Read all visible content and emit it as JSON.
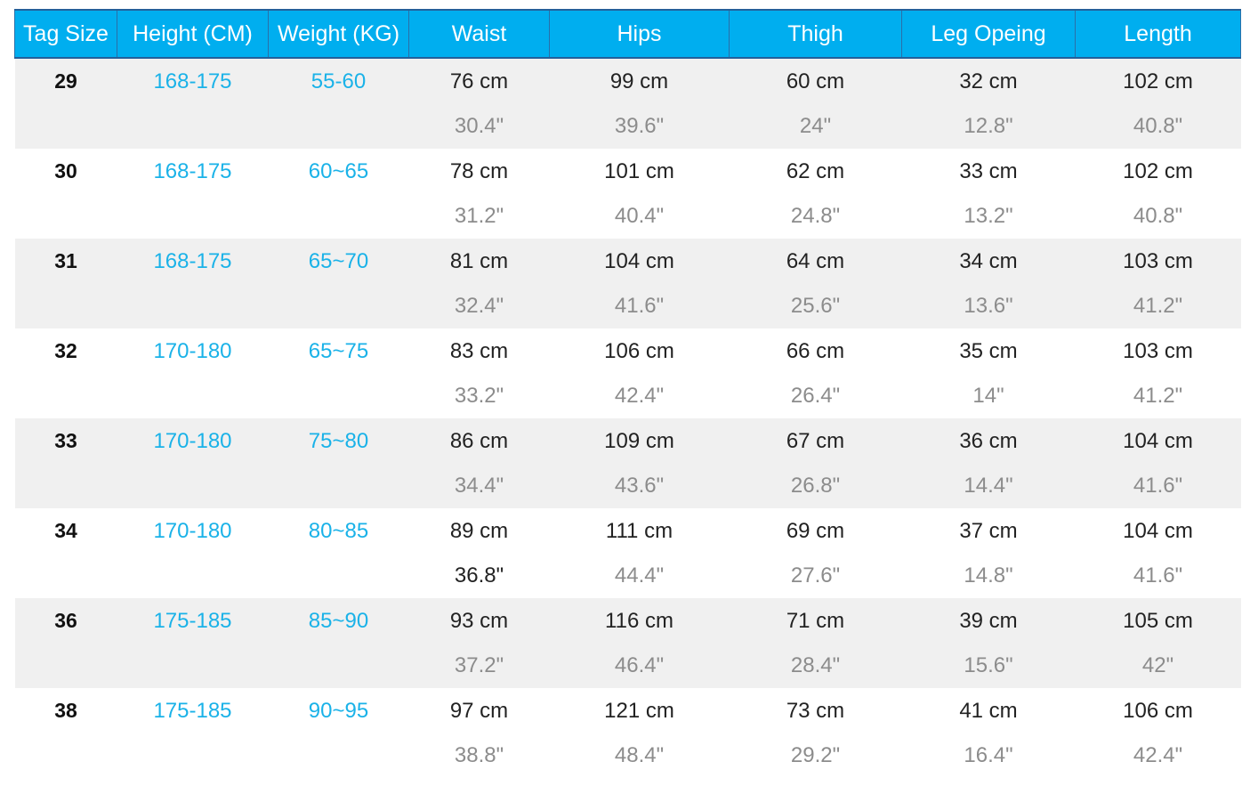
{
  "headers": [
    "Tag Size",
    "Height (CM)",
    "Weight (KG)",
    "Waist",
    "Hips",
    "Thigh",
    "Leg Opeing",
    "Length"
  ],
  "rows": [
    {
      "size": "29",
      "height": "168-175",
      "weight": "55-60",
      "cm": [
        "76 cm",
        "99 cm",
        "60 cm",
        "32 cm",
        "102 cm"
      ],
      "inch": [
        "30.4\"",
        "39.6\"",
        "24\"",
        "12.8\"",
        "40.8\""
      ]
    },
    {
      "size": "30",
      "height": "168-175",
      "weight": "60~65",
      "cm": [
        "78 cm",
        "101 cm",
        "62 cm",
        "33 cm",
        "102 cm"
      ],
      "inch": [
        "31.2\"",
        "40.4\"",
        "24.8\"",
        "13.2\"",
        "40.8\""
      ]
    },
    {
      "size": "31",
      "height": "168-175",
      "weight": "65~70",
      "cm": [
        "81 cm",
        "104 cm",
        "64 cm",
        "34 cm",
        "103 cm"
      ],
      "inch": [
        "32.4\"",
        "41.6\"",
        "25.6\"",
        "13.6\"",
        "41.2\""
      ]
    },
    {
      "size": "32",
      "height": "170-180",
      "weight": "65~75",
      "cm": [
        "83 cm",
        "106 cm",
        "66 cm",
        "35 cm",
        "103 cm"
      ],
      "inch": [
        "33.2\"",
        "42.4\"",
        "26.4\"",
        "14\"",
        "41.2\""
      ]
    },
    {
      "size": "33",
      "height": "170-180",
      "weight": "75~80",
      "cm": [
        "86 cm",
        "109 cm",
        "67 cm",
        "36 cm",
        "104 cm"
      ],
      "inch": [
        "34.4\"",
        "43.6\"",
        "26.8\"",
        "14.4\"",
        "41.6\""
      ]
    },
    {
      "size": "34",
      "height": "170-180",
      "weight": "80~85",
      "cm": [
        "89 cm",
        "111 cm",
        "69 cm",
        "37 cm",
        "104 cm"
      ],
      "inch": [
        "36.8\"",
        "44.4\"",
        "27.6\"",
        "14.8\"",
        "41.6\""
      ]
    },
    {
      "size": "36",
      "height": "175-185",
      "weight": "85~90",
      "cm": [
        "93 cm",
        "116 cm",
        "71 cm",
        "39 cm",
        "105 cm"
      ],
      "inch": [
        "37.2\"",
        "46.4\"",
        "28.4\"",
        "15.6\"",
        "42\""
      ]
    },
    {
      "size": "38",
      "height": "175-185",
      "weight": "90~95",
      "cm": [
        "97 cm",
        "121 cm",
        "73 cm",
        "41 cm",
        "106 cm"
      ],
      "inch": [
        "38.8\"",
        "48.4\"",
        "29.2\"",
        "16.4\"",
        "42.4\""
      ]
    }
  ]
}
